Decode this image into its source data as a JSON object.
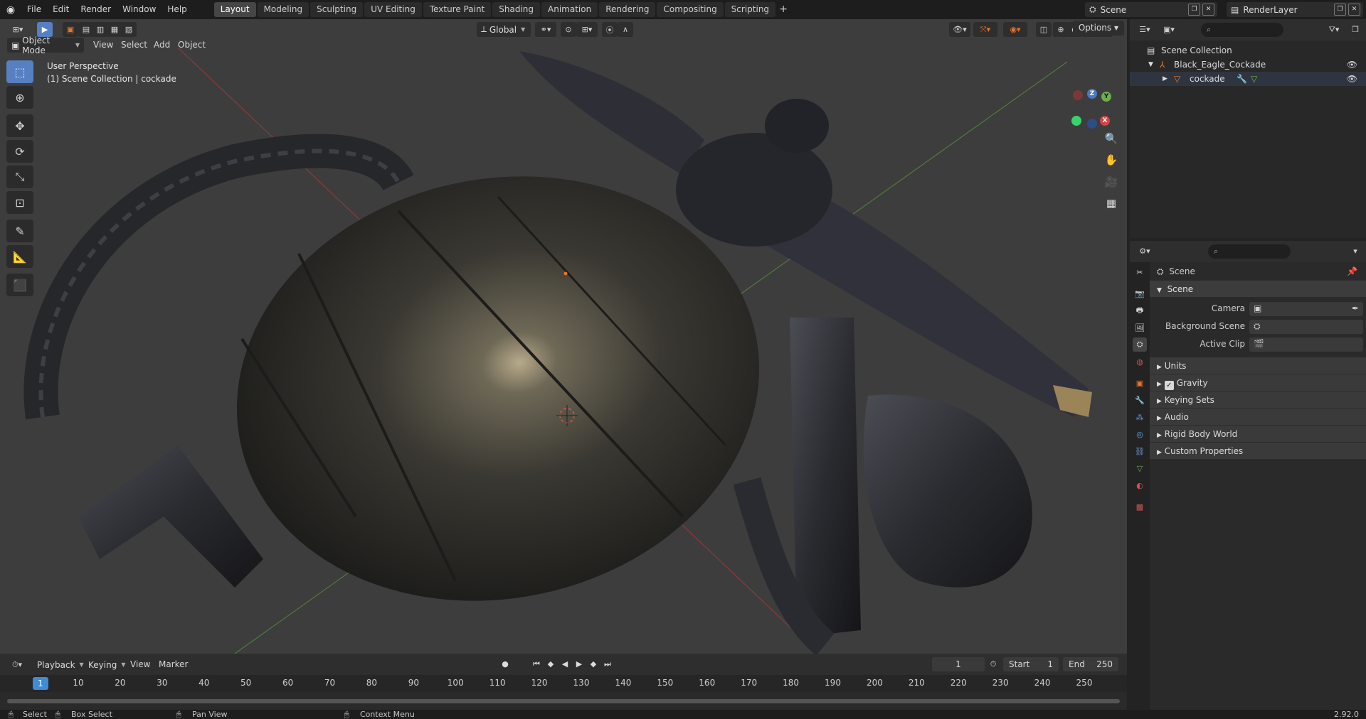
{
  "topbar": {
    "menus": [
      "File",
      "Edit",
      "Render",
      "Window",
      "Help"
    ],
    "workspaces": [
      "Layout",
      "Modeling",
      "Sculpting",
      "UV Editing",
      "Texture Paint",
      "Shading",
      "Animation",
      "Rendering",
      "Compositing",
      "Scripting"
    ],
    "active_workspace": "Layout",
    "add_tab": "+",
    "scene_label": "Scene",
    "render_layer_label": "RenderLayer"
  },
  "viewport": {
    "mode": "Object Mode",
    "menus": [
      "View",
      "Select",
      "Add",
      "Object"
    ],
    "transform_orientation": "Global",
    "options_label": "Options",
    "info_line1": "User Perspective",
    "info_line2": "(1) Scene Collection | cockade",
    "gizmo": {
      "x": "X",
      "y": "Y",
      "z": "Z"
    }
  },
  "timeline": {
    "menus": [
      "Playback",
      "Keying",
      "View",
      "Marker"
    ],
    "ticks": [
      "1",
      "10",
      "20",
      "30",
      "40",
      "50",
      "60",
      "70",
      "80",
      "90",
      "100",
      "110",
      "120",
      "130",
      "140",
      "150",
      "160",
      "170",
      "180",
      "190",
      "200",
      "210",
      "220",
      "230",
      "240",
      "250"
    ],
    "current_frame": "1",
    "start_label": "Start",
    "start_value": "1",
    "end_label": "End",
    "end_value": "250"
  },
  "statusbar": {
    "select": "Select",
    "box_select": "Box Select",
    "pan_view": "Pan View",
    "context_menu": "Context Menu",
    "version": "2.92.0"
  },
  "outliner": {
    "root": "Scene Collection",
    "collection": "Black_Eagle_Cockade",
    "object": "cockade"
  },
  "properties": {
    "header": "Scene",
    "panel": "Scene",
    "camera_label": "Camera",
    "background_scene_label": "Background Scene",
    "active_clip_label": "Active Clip",
    "subpanels": {
      "units": "Units",
      "gravity": "Gravity",
      "keying_sets": "Keying Sets",
      "audio": "Audio",
      "rigid_body_world": "Rigid Body World",
      "custom_properties": "Custom Properties"
    },
    "gravity_checked": true
  },
  "colors": {
    "accent": "#5680c2",
    "frame_indicator": "#3f8bd6",
    "axis_x": "#d34545",
    "axis_y": "#6ab04c",
    "axis_z": "#4a78c8"
  }
}
